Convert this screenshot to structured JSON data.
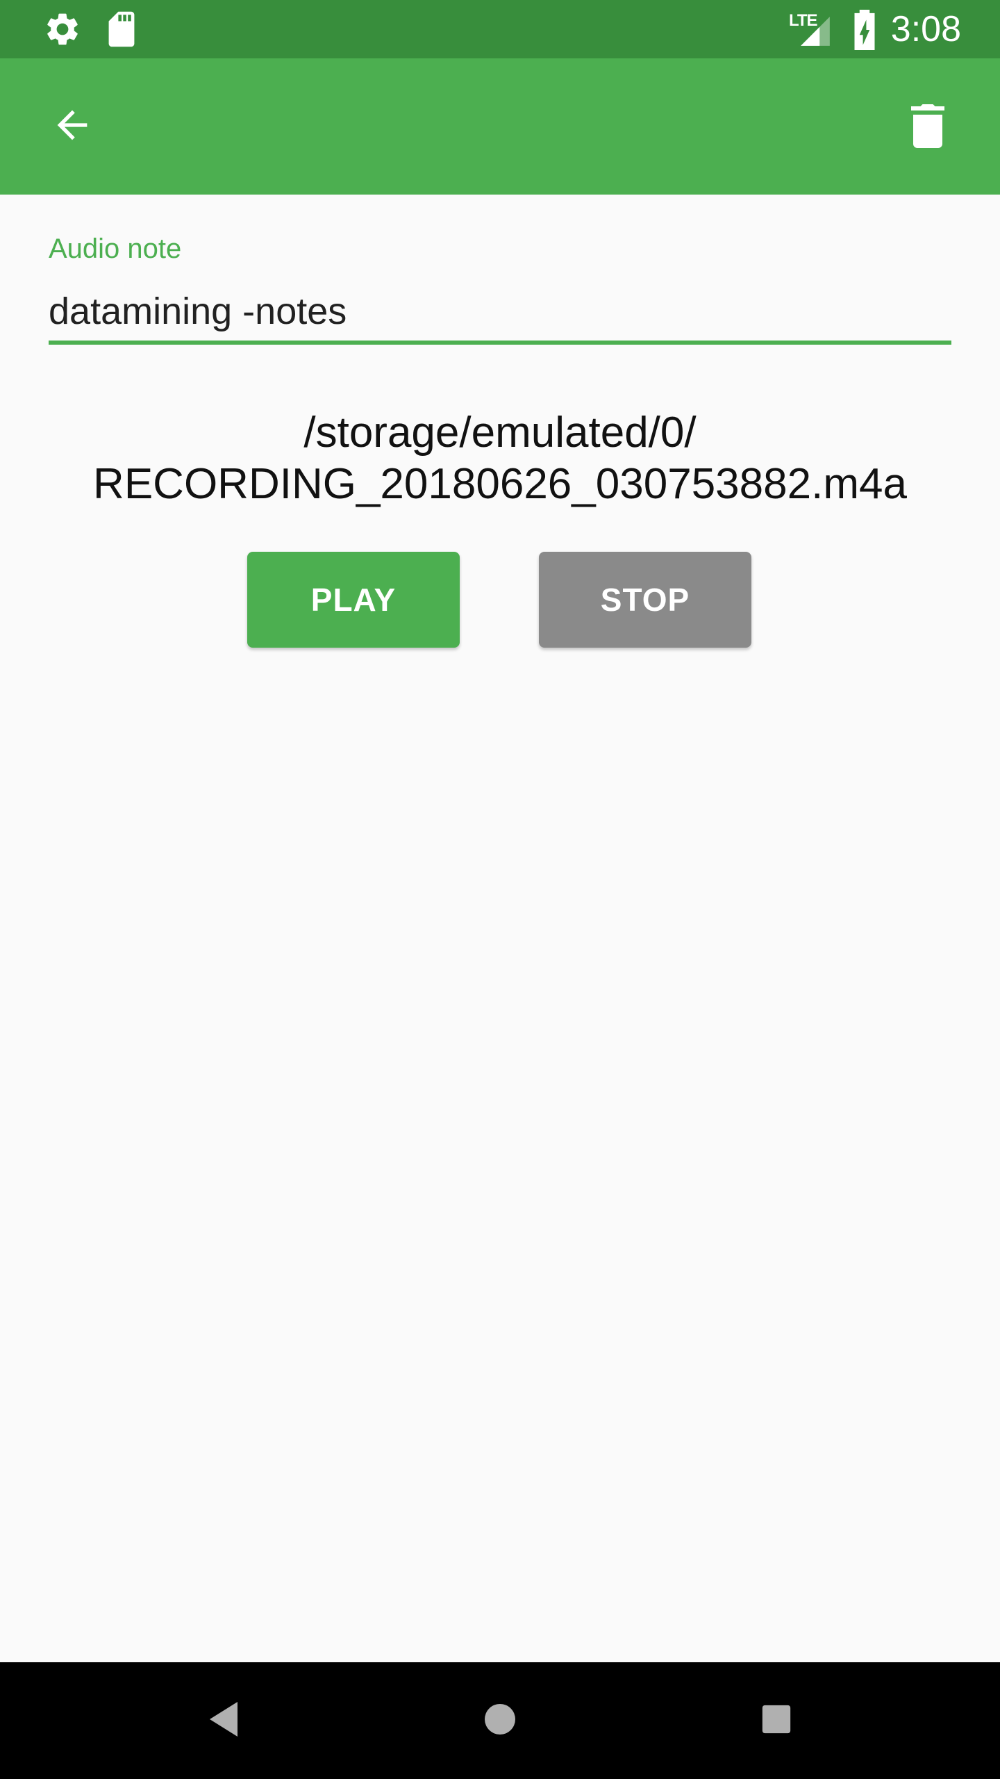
{
  "status_bar": {
    "time": "3:08",
    "network_label": "LTE",
    "icons": [
      "settings-icon",
      "sd-card-icon",
      "signal-icon",
      "battery-charging-icon"
    ]
  },
  "toolbar": {
    "back_icon": "arrow-back-icon",
    "delete_icon": "trash-icon"
  },
  "note": {
    "label": "Audio note",
    "value": "datamining -notes"
  },
  "file": {
    "path_line1": "/storage/emulated/0/",
    "path_line2": "RECORDING_20180626_030753882.m4a"
  },
  "controls": {
    "play_label": "PLAY",
    "stop_label": "STOP"
  },
  "nav": {
    "icons": [
      "nav-back-icon",
      "nav-home-icon",
      "nav-recents-icon"
    ]
  },
  "colors": {
    "status_bar": "#388e3c",
    "toolbar": "#4caf50",
    "accent": "#4caf50",
    "stop_button": "#8a8a8a",
    "background": "#fafafa"
  }
}
